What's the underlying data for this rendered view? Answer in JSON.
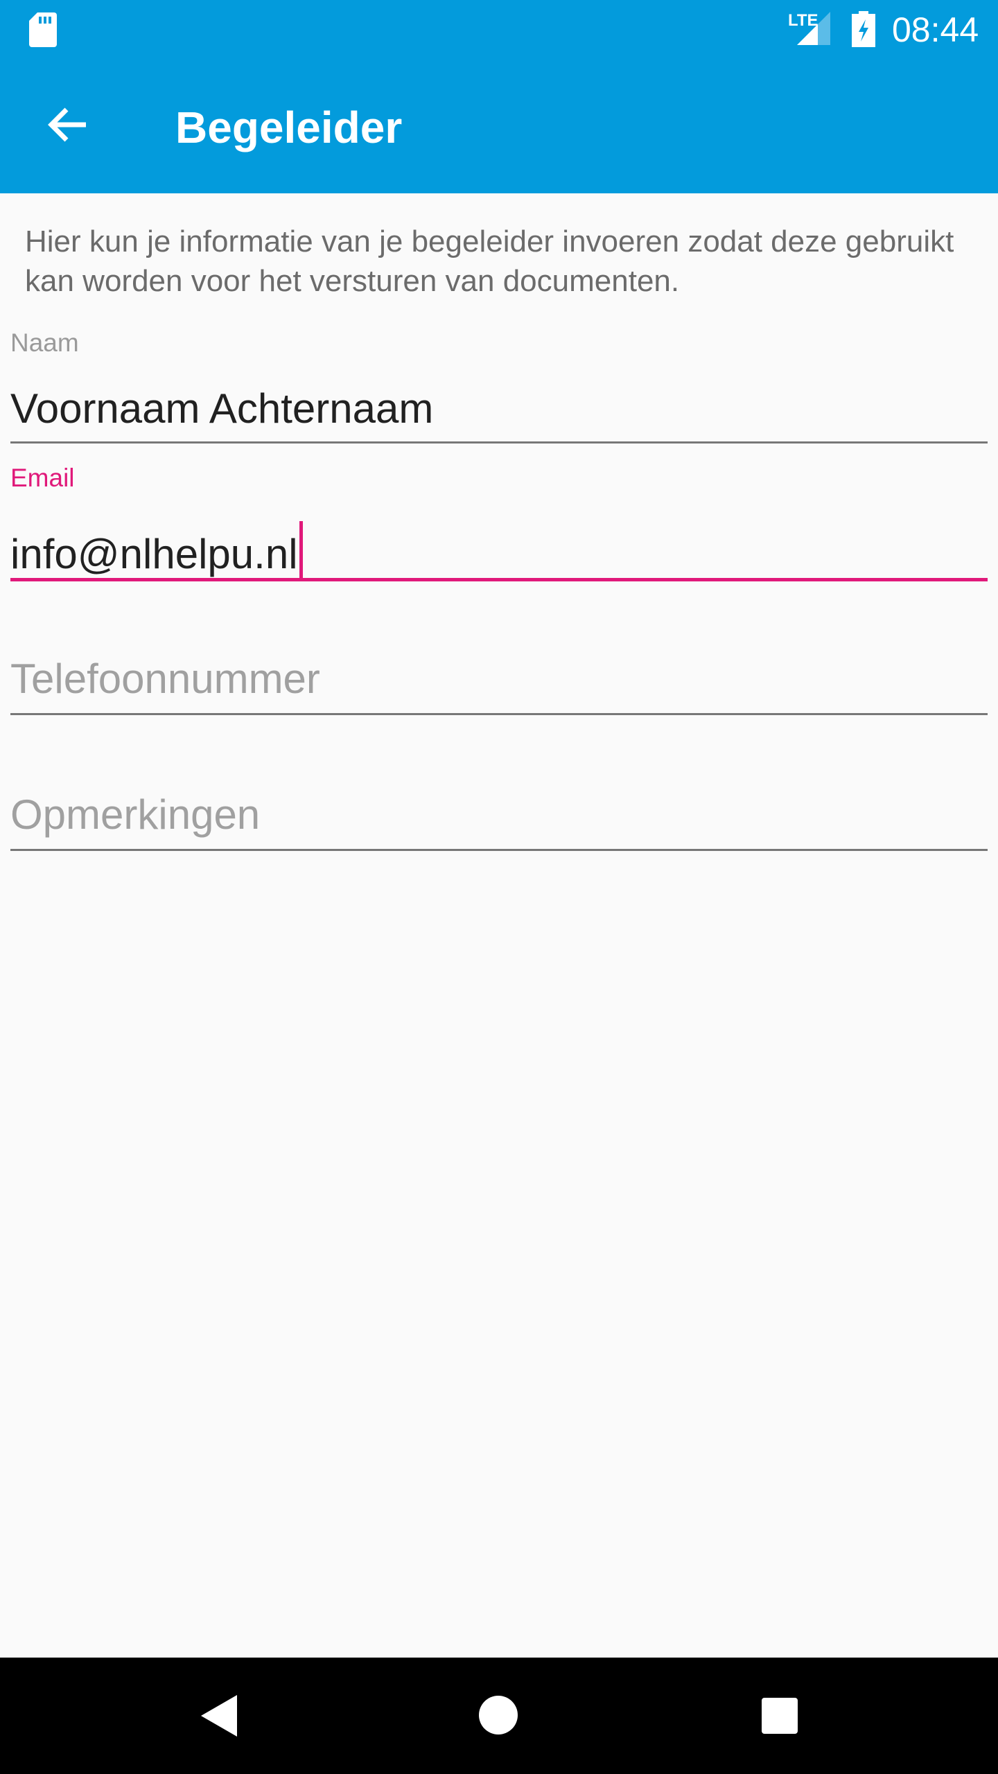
{
  "status_bar": {
    "time": "08:44",
    "network": "LTE"
  },
  "app_bar": {
    "title": "Begeleider"
  },
  "description": "Hier kun je informatie van je begeleider invoeren zodat deze gebruikt kan worden voor het versturen van documenten.",
  "form": {
    "name": {
      "label": "Naam",
      "value": "Voornaam Achternaam"
    },
    "email": {
      "label": "Email",
      "value": "info@nlhelpu.nl"
    },
    "phone": {
      "placeholder": "Telefoonnummer"
    },
    "remarks": {
      "placeholder": "Opmerkingen"
    }
  },
  "colors": {
    "primary": "#039bdc",
    "accent": "#e0197a"
  }
}
